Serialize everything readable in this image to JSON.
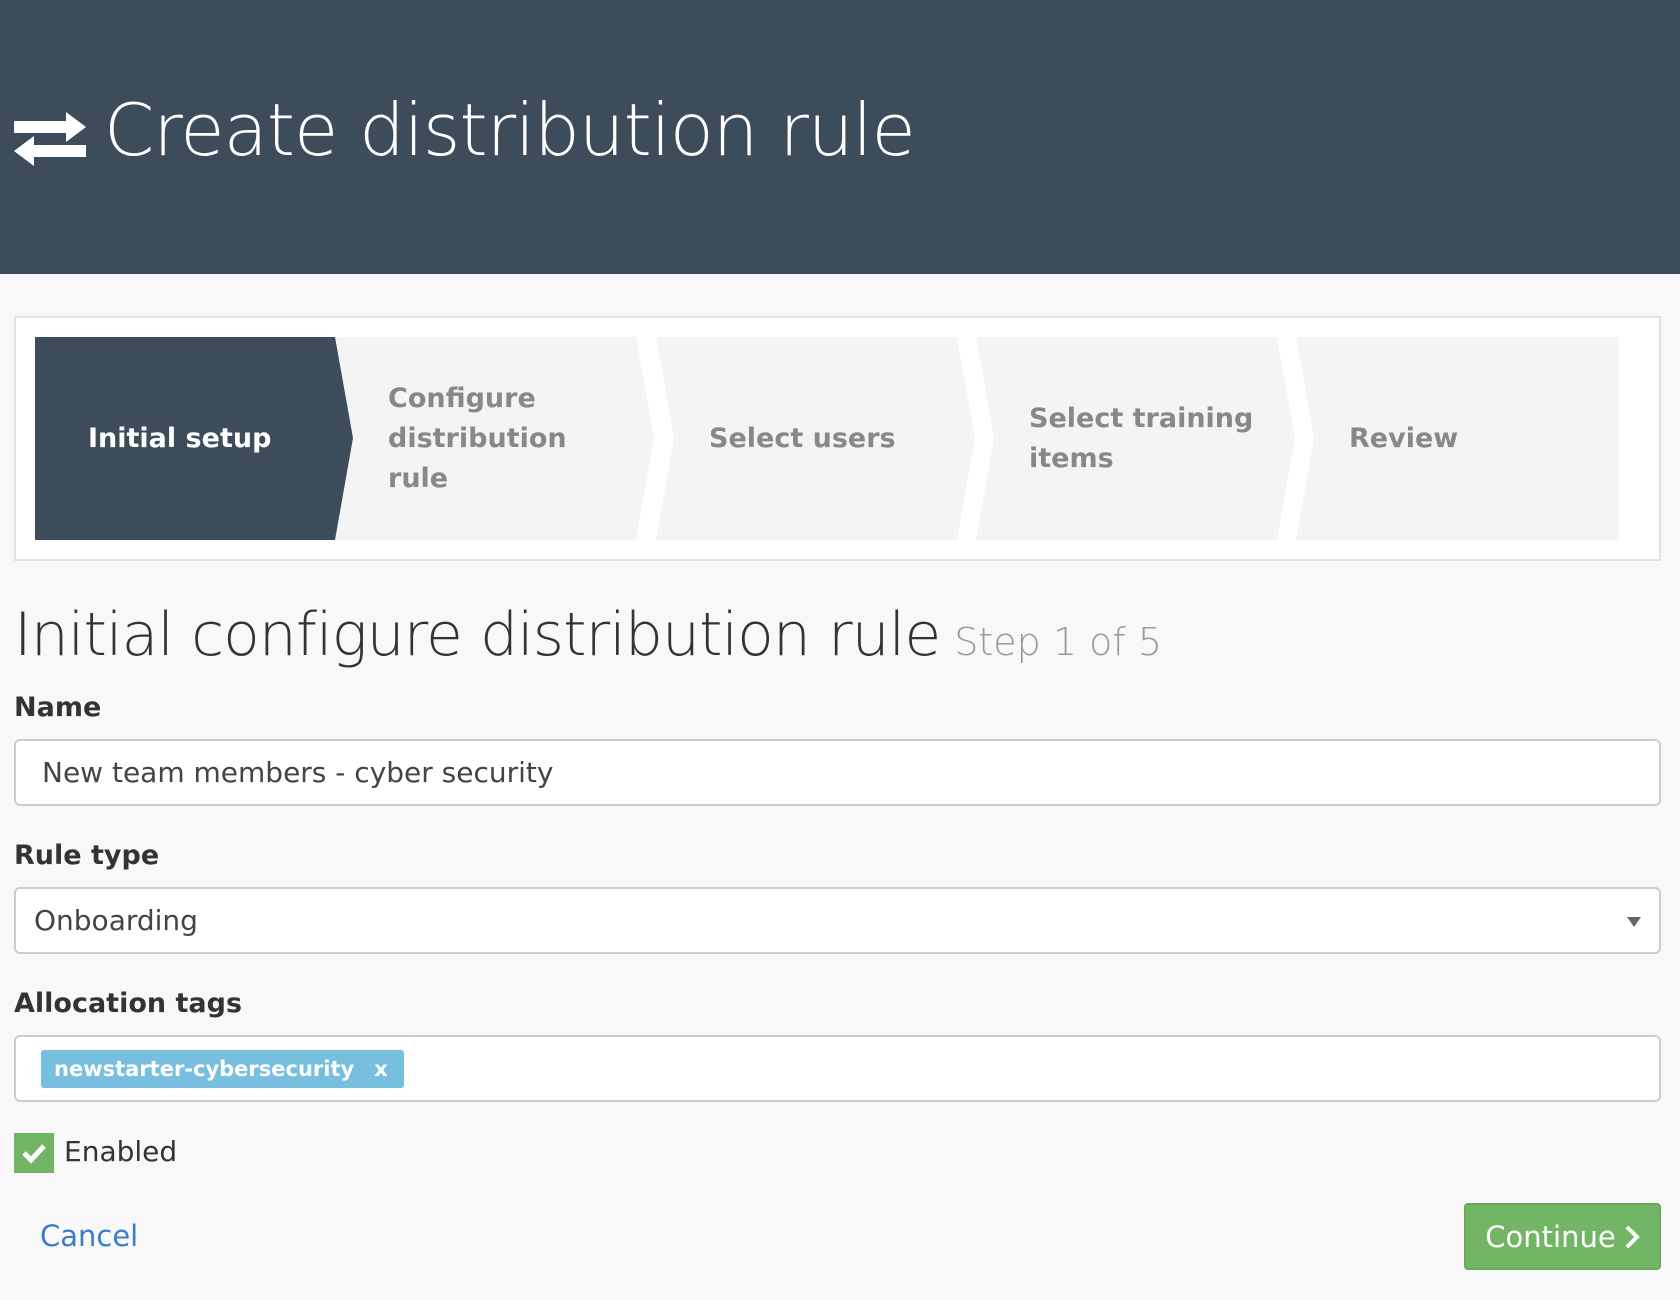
{
  "header": {
    "title": "Create distribution rule",
    "icon": "exchange-arrows-icon"
  },
  "stepper": {
    "steps": [
      {
        "label": "Initial setup",
        "active": true
      },
      {
        "label": "Configure distribution rule",
        "active": false
      },
      {
        "label": "Select users",
        "active": false
      },
      {
        "label": "Select training items",
        "active": false
      },
      {
        "label": "Review",
        "active": false
      }
    ]
  },
  "main": {
    "heading": "Initial configure distribution rule",
    "step_indicator": "Step 1 of 5",
    "name": {
      "label": "Name",
      "value": "New team members - cyber security"
    },
    "rule_type": {
      "label": "Rule type",
      "value": "Onboarding"
    },
    "allocation_tags": {
      "label": "Allocation tags",
      "tags": [
        {
          "text": "newstarter-cybersecurity",
          "remove": "x"
        }
      ]
    },
    "enabled": {
      "label": "Enabled",
      "checked": true
    },
    "cancel_label": "Cancel",
    "continue_label": "Continue"
  },
  "colors": {
    "header": "#3d4c5a",
    "active_step": "#3d4c5a",
    "inactive_step": "#f4f4f4",
    "success": "#72b565",
    "tag": "#78bfdf",
    "link": "#3a7dc9"
  }
}
